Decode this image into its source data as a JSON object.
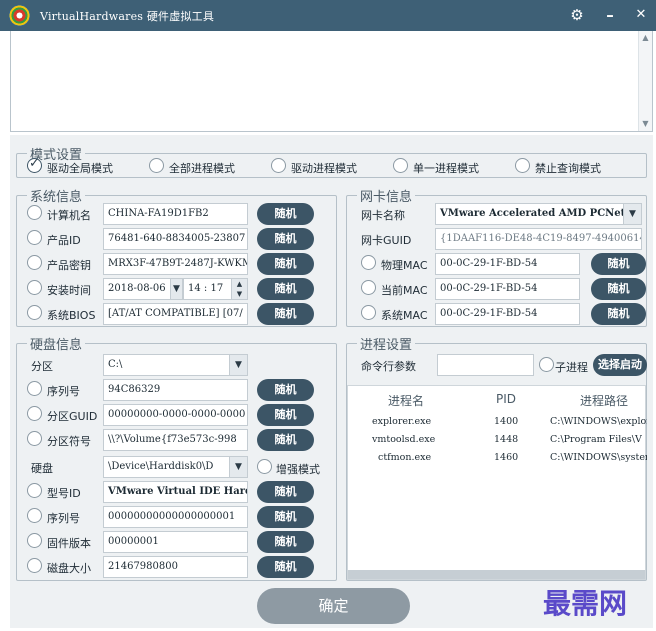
{
  "titlebar": {
    "title": "VirtualHardwares 硬件虚拟工具",
    "settings_icon": "⚙",
    "minimize_icon": "–",
    "close_icon": "✕"
  },
  "mode": {
    "legend": "模式设置",
    "options": [
      "驱动全局模式",
      "全部进程模式",
      "驱动进程模式",
      "单一进程模式",
      "禁止查询模式"
    ],
    "selected_index": 0
  },
  "system": {
    "legend": "系统信息",
    "random_label": "随机",
    "rows": [
      {
        "label": "计算机名",
        "value": "CHINA-FA19D1FB2"
      },
      {
        "label": "产品ID",
        "value": "76481-640-8834005-23807"
      },
      {
        "label": "产品密钥",
        "value": "MRX3F-47B9T-2487J-KWKM"
      },
      {
        "label": "安装时间",
        "date": "2018-08-06",
        "time": "14 : 17"
      },
      {
        "label": "系统BIOS",
        "value": "[AT/AT COMPATIBLE] [07/"
      }
    ]
  },
  "nic": {
    "legend": "网卡信息",
    "random_label": "随机",
    "name_label": "网卡名称",
    "name_value": "VMware Accelerated AMD PCNet",
    "guid_label": "网卡GUID",
    "guid_value": "{1DAAF116-DE48-4C19-8497-49400614",
    "macs": [
      {
        "label": "物理MAC",
        "value": "00-0C-29-1F-BD-54"
      },
      {
        "label": "当前MAC",
        "value": "00-0C-29-1F-BD-54"
      },
      {
        "label": "系统MAC",
        "value": "00-0C-29-1F-BD-54"
      }
    ]
  },
  "disk": {
    "legend": "硬盘信息",
    "random_label": "随机",
    "partition_label": "分区",
    "partition_value": "C:\\",
    "partition_rows": [
      {
        "label": "序列号",
        "value": "94C86329"
      },
      {
        "label": "分区GUID",
        "value": "00000000-0000-0000-0000"
      },
      {
        "label": "分区符号",
        "value": "\\\\?\\Volume{f73e573c-998"
      }
    ],
    "disk_label": "硬盘",
    "disk_value": "\\Device\\Harddisk0\\D",
    "enhance_label": "增强模式",
    "disk_rows": [
      {
        "label": "型号ID",
        "value": "VMware Virtual IDE Hard"
      },
      {
        "label": "序列号",
        "value": "00000000000000000001"
      },
      {
        "label": "固件版本",
        "value": "00000001"
      },
      {
        "label": "磁盘大小",
        "value": "21467980800"
      }
    ]
  },
  "process": {
    "legend": "进程设置",
    "cmd_label": "命令行参数",
    "cmd_value": "",
    "child_label": "子进程",
    "select_button": "选择启动",
    "columns": [
      "进程名",
      "PID",
      "进程路径"
    ],
    "rows": [
      {
        "name": "explorer.exe",
        "pid": "1400",
        "path": "C:\\WINDOWS\\explorer"
      },
      {
        "name": "vmtoolsd.exe",
        "pid": "1448",
        "path": "C:\\Program Files\\V"
      },
      {
        "name": "ctfmon.exe",
        "pid": "1460",
        "path": "C:\\WINDOWS\\system3"
      }
    ]
  },
  "ok_button": "确定",
  "watermark": "最需网"
}
